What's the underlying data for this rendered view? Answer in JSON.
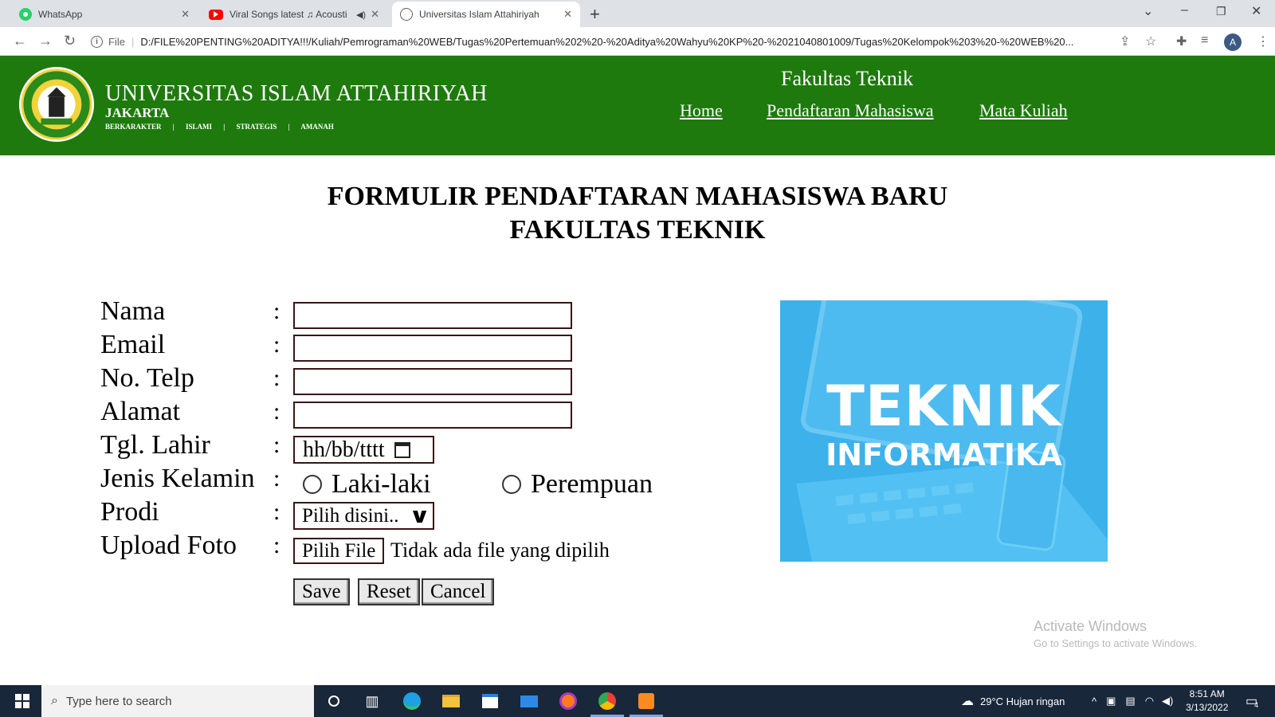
{
  "browser": {
    "tabs": [
      {
        "title": "WhatsApp",
        "icon": "whatsapp-icon"
      },
      {
        "title": "Viral Songs latest ♫ Acousti",
        "icon": "youtube-icon"
      },
      {
        "title": "Universitas Islam Attahiriyah",
        "icon": "globe-icon"
      }
    ],
    "scheme": "File",
    "url": "D:/FILE%20PENTING%20ADITYA!!!/Kuliah/Pemrograman%20WEB/Tugas%20Pertemuan%202%20-%20Aditya%20Wahyu%20KP%20-%2021040801009/Tugas%20Kelompok%203%20-%20WEB%20...",
    "profile_initial": "A"
  },
  "header": {
    "university": "UNIVERSITAS ISLAM ATTAHIRIYAH",
    "city": "JAKARTA",
    "motto": [
      "BERKARAKTER",
      "|",
      "ISLAMI",
      "|",
      "STRATEGIS",
      "|",
      "AMANAH"
    ],
    "faculty": "Fakultas Teknik",
    "nav": [
      "Home",
      "Pendaftaran Mahasiswa",
      "Mata Kuliah"
    ]
  },
  "form": {
    "title_line1": "FORMULIR PENDAFTARAN MAHASISWA BARU",
    "title_line2": "FAKULTAS TEKNIK",
    "labels": {
      "nama": "Nama",
      "email": "Email",
      "telp": "No. Telp",
      "alamat": "Alamat",
      "tgl": "Tgl. Lahir",
      "jk": "Jenis Kelamin",
      "prodi": "Prodi",
      "foto": "Upload Foto"
    },
    "colon": ":",
    "date_placeholder": "hh/bb/tttt",
    "gender_options": [
      "Laki-laki",
      "Perempuan"
    ],
    "prodi_selected": "Pilih disini..",
    "file_button": "Pilih File",
    "file_status": "Tidak ada file yang dipilih",
    "buttons": {
      "save": "Save",
      "reset": "Reset",
      "cancel": "Cancel"
    }
  },
  "banner": {
    "line1": "TEKNIK",
    "line2": "INFORMATIKA"
  },
  "watermark": {
    "line1": "Activate Windows",
    "line2": "Go to Settings to activate Windows."
  },
  "taskbar": {
    "search_placeholder": "Type here to search",
    "weather": "29°C  Hujan ringan",
    "time": "8:51 AM",
    "date": "3/13/2022",
    "notification_count": "4"
  }
}
